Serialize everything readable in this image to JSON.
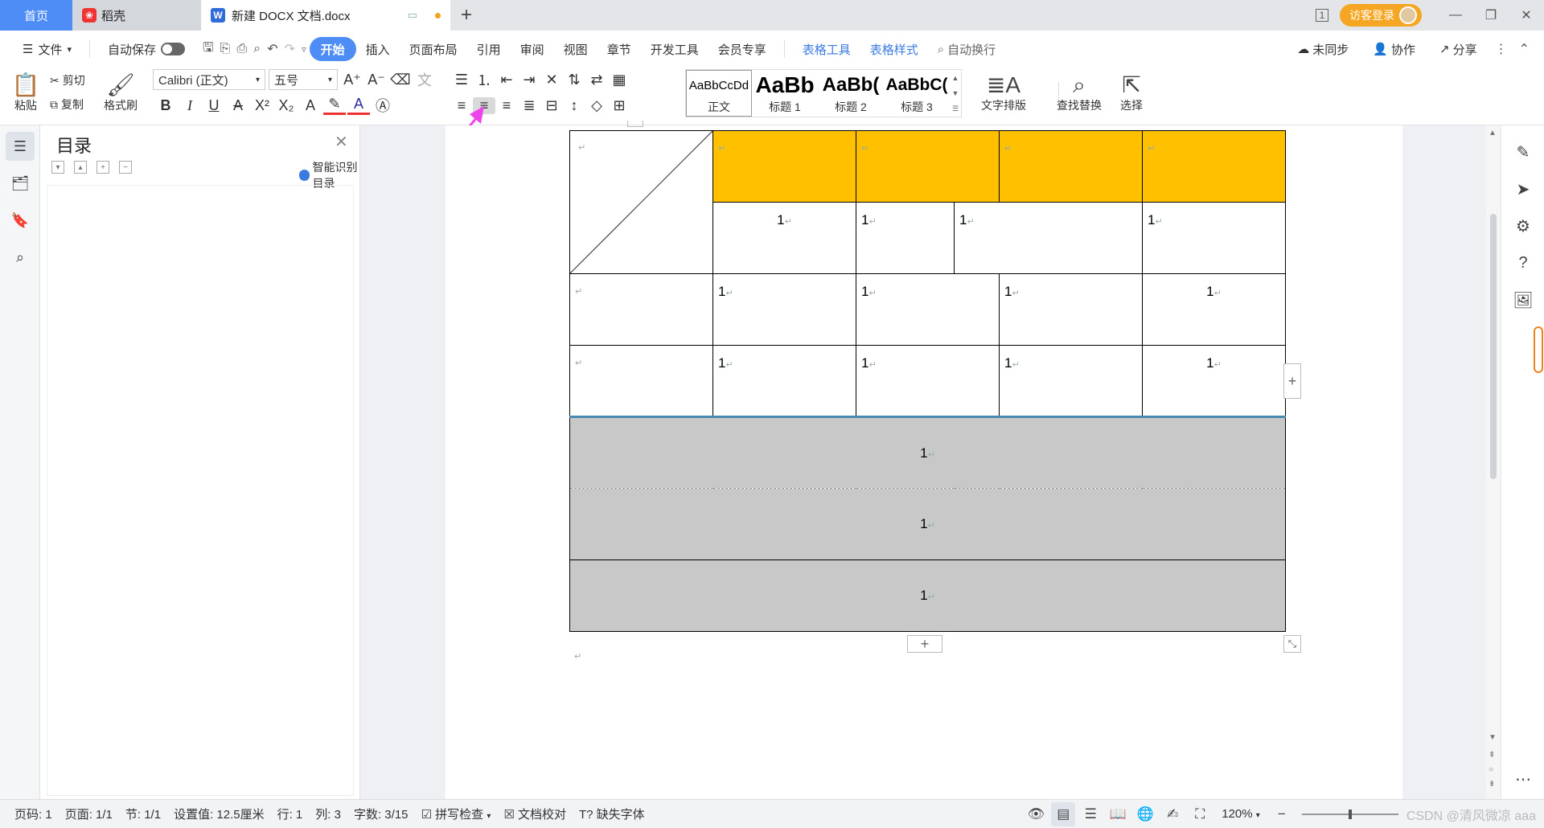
{
  "tabs": {
    "home": "首页",
    "daoke": "稻壳",
    "doc": "新建 DOCX 文档.docx",
    "new_tab": "+"
  },
  "window": {
    "page_indicator": "1",
    "login_label": "访客登录",
    "minimize": "—",
    "restore": "❐",
    "close": "✕"
  },
  "menu": {
    "file": "文件",
    "autosave": "自动保存",
    "items": [
      "开始",
      "插入",
      "页面布局",
      "引用",
      "审阅",
      "视图",
      "章节",
      "开发工具",
      "会员专享"
    ],
    "table_tools": "表格工具",
    "table_style": "表格样式",
    "search": "自动换行",
    "unsynced": "未同步",
    "collab": "协作",
    "share": "分享"
  },
  "ribbon": {
    "paste": "粘贴",
    "cut": "剪切",
    "copy": "复制",
    "format_painter": "格式刷",
    "font_name": "Calibri (正文)",
    "font_size": "五号",
    "styles": [
      {
        "preview": "AaBbCcDd",
        "label": "正文"
      },
      {
        "preview": "AaBb",
        "label": "标题 1"
      },
      {
        "preview": "AaBb(",
        "label": "标题 2"
      },
      {
        "preview": "AaBbC(",
        "label": "标题 3"
      }
    ],
    "text_layout": "文字排版",
    "find_replace": "查找替换",
    "select": "选择"
  },
  "toc": {
    "title": "目录",
    "smart": "智能识别目录"
  },
  "table": {
    "para_mark": "↵",
    "rows": [
      {
        "cells": [
          {
            "text": "",
            "orange": false,
            "diag": true
          },
          {
            "text": "",
            "orange": true
          },
          {
            "text": "",
            "orange": true
          },
          {
            "text": "",
            "orange": true
          },
          {
            "text": "",
            "orange": true
          }
        ]
      },
      {
        "cells": [
          {
            "text": "1"
          },
          {
            "text": "1"
          },
          {
            "text": "1"
          },
          {
            "text": "1"
          }
        ]
      },
      {
        "cells": [
          {
            "text": ""
          },
          {
            "text": "1"
          },
          {
            "text": "1"
          },
          {
            "text": "1"
          },
          {
            "text": "1"
          }
        ]
      },
      {
        "cells": [
          {
            "text": ""
          },
          {
            "text": "1"
          },
          {
            "text": "1"
          },
          {
            "text": "1"
          },
          {
            "text": "1"
          }
        ]
      },
      {
        "cells": [
          {
            "text": "1"
          }
        ]
      },
      {
        "cells": [
          {
            "text": "1"
          }
        ]
      },
      {
        "cells": [
          {
            "text": "1"
          }
        ]
      }
    ],
    "add_symbol": "+"
  },
  "status": {
    "page_no": "页码: 1",
    "pages": "页面: 1/1",
    "section": "节: 1/1",
    "setting": "设置值: 12.5厘米",
    "line": "行: 1",
    "col": "列: 3",
    "words": "字数: 3/15",
    "spell": "拼写检查",
    "proof": "文档校对",
    "missing_font": "缺失字体",
    "zoom": "120%",
    "watermark": "CSDN @清风微凉 aaa"
  },
  "colors": {
    "accent": "#4e8cf6",
    "orange_cell": "#ffc000",
    "gray_cell": "#c8c8c8",
    "login": "#f5a623",
    "annotation_arrow": "#ee44ee"
  }
}
